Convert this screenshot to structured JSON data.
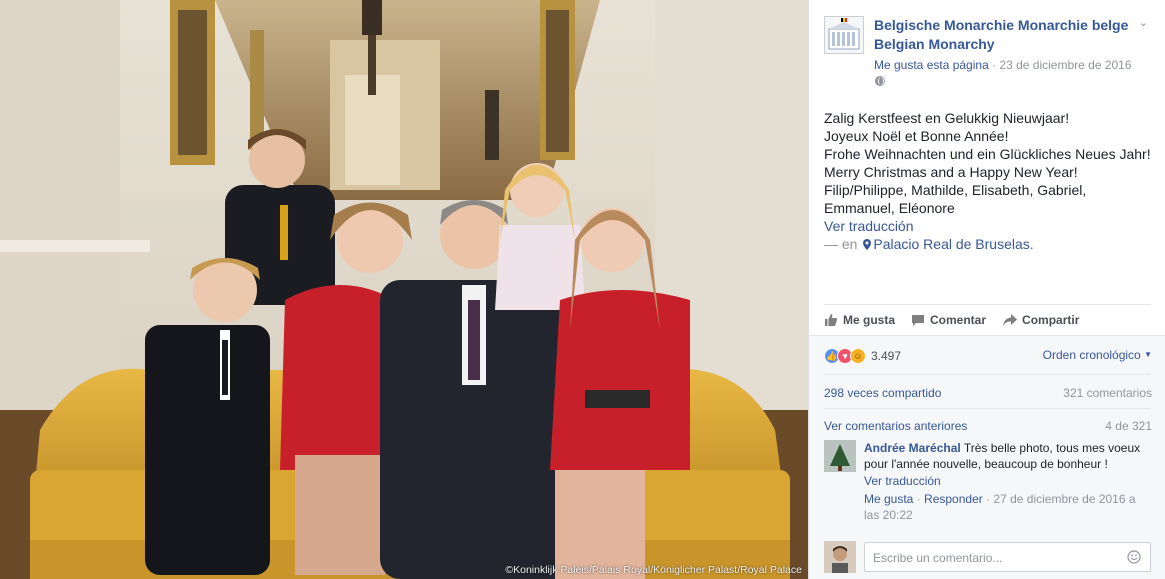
{
  "photo": {
    "credit": "©Koninklijk Paleis/Palais Royal/Königlicher Palast/Royal Palace"
  },
  "post": {
    "page_name": "Belgische Monarchie Monarchie belge Belgian Monarchy",
    "like_page": "Me gusta esta página",
    "separator": " · ",
    "date": "23 de diciembre de 2016",
    "lines": [
      "Zalig Kerstfeest en Gelukkig Nieuwjaar!",
      "Joyeux Noël et Bonne Année!",
      "Frohe Weihnachten und ein Glückliches Neues Jahr!",
      "Merry Christmas and a Happy New Year!",
      "Filip/Philippe, Mathilde, Elisabeth, Gabriel, Emmanuel, Eléonore"
    ],
    "translate": "Ver traducción",
    "location_prefix": "— en",
    "location": "Palacio Real de Bruselas."
  },
  "actions": {
    "like": "Me gusta",
    "comment": "Comentar",
    "share": "Compartir"
  },
  "social": {
    "reaction_count": "3.497",
    "order": "Orden cronológico",
    "shares": "298 veces compartido",
    "comments": "321 comentarios",
    "prev_comments": "Ver comentarios anteriores",
    "pager": "4 de 321"
  },
  "comment": {
    "author": "Andrée Maréchal",
    "text": "Très belle photo, tous mes voeux pour l'année nouvelle, beaucoup de bonheur !",
    "translate": "Ver traducción",
    "like": "Me gusta",
    "reply": "Responder",
    "date": "27 de diciembre de 2016 a las 20:22"
  },
  "composer": {
    "placeholder": "Escribe un comentario..."
  },
  "colors": {
    "link": "#365899",
    "muted": "#90949c",
    "dress_red": "#c8202a",
    "sofa_gold": "#d9a632"
  }
}
